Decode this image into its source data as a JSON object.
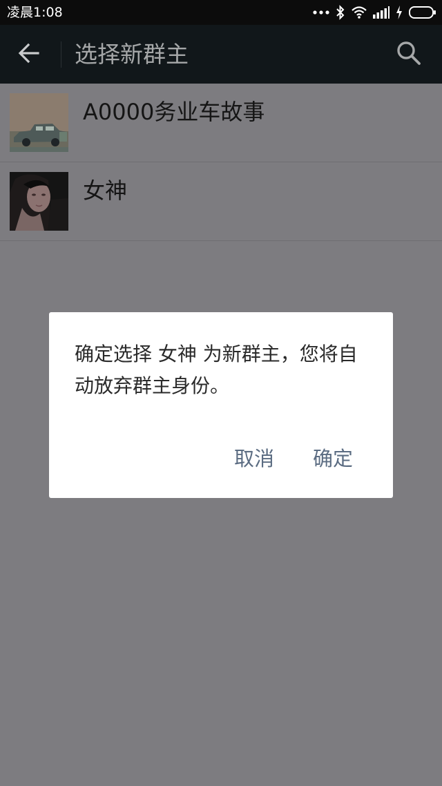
{
  "status_bar": {
    "time": "凌晨1:08",
    "icons": [
      "dots-icon",
      "bluetooth-icon",
      "wifi-icon",
      "signal-icon",
      "charging-icon",
      "battery-icon"
    ]
  },
  "action_bar": {
    "title": "选择新群主",
    "back_icon": "arrow-left-icon",
    "search_icon": "search-icon"
  },
  "members": [
    {
      "name": "A0000务业车故事",
      "avatar": "car-photo"
    },
    {
      "name": "女神",
      "avatar": "portrait-photo"
    }
  ],
  "dialog": {
    "message": "确定选择 女神 为新群主，您将自动放弃群主身份。",
    "cancel_label": "取消",
    "confirm_label": "确定"
  },
  "colors": {
    "status_bar_bg": "#0c0c0c",
    "action_bar_bg": "#11171a",
    "overlay_bg": "#7d7c80",
    "dialog_button_text": "#5b6c82"
  }
}
